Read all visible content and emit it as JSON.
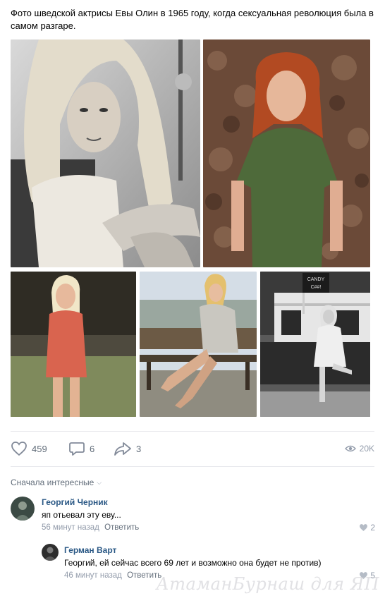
{
  "post": {
    "text": "Фото шведской актрисы Евы Олин в 1965 году, когда сексуальная революция была в самом разгаре."
  },
  "actions": {
    "likes": "459",
    "comments": "6",
    "shares": "3",
    "views": "20K"
  },
  "comments_section": {
    "sort_label": "Сначала интересные"
  },
  "comments": [
    {
      "author": "Георгий Черник",
      "text": "яп отьевал эту еву...",
      "time": "56 минут назад",
      "reply_label": "Ответить",
      "likes": "2"
    },
    {
      "author": "Герман Варт",
      "text": "Георгий, ей сейчас всего 69 лет и возможно она будет не против)",
      "time": "46 минут назад",
      "reply_label": "Ответить",
      "likes": "5"
    }
  ],
  "watermark": "АтаманБурнаш для ЯП",
  "colors": {
    "link": "#2a5885",
    "secondary": "#626d7a",
    "muted": "#939cab",
    "divider": "#e7e8ec"
  }
}
